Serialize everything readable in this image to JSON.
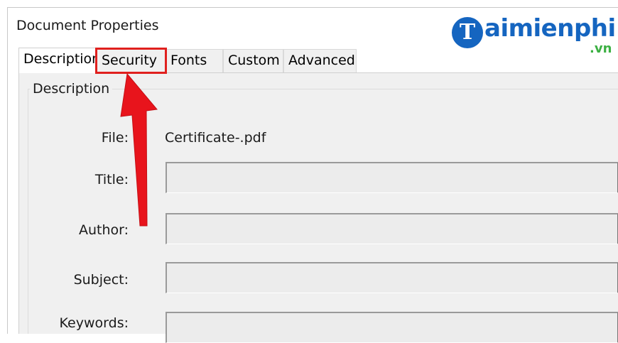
{
  "window": {
    "title": "Document Properties"
  },
  "tabs": [
    {
      "label": "Description",
      "active": true
    },
    {
      "label": "Security",
      "highlighted": true
    },
    {
      "label": "Fonts"
    },
    {
      "label": "Custom"
    },
    {
      "label": "Advanced"
    }
  ],
  "description_group": {
    "legend": "Description",
    "file_label": "File:",
    "file_value": "Certificate-.pdf",
    "title_label": "Title:",
    "title_value": "",
    "author_label": "Author:",
    "author_value": "",
    "subject_label": "Subject:",
    "subject_value": "",
    "keywords_label": "Keywords:",
    "keywords_value": ""
  },
  "watermark": {
    "letter": "T",
    "text": "aimienphi",
    "suffix": ".vn"
  },
  "colors": {
    "highlight": "#e0201e",
    "arrow": "#e8141c",
    "logo_blue": "#1565c0",
    "logo_green": "#3cb043"
  }
}
